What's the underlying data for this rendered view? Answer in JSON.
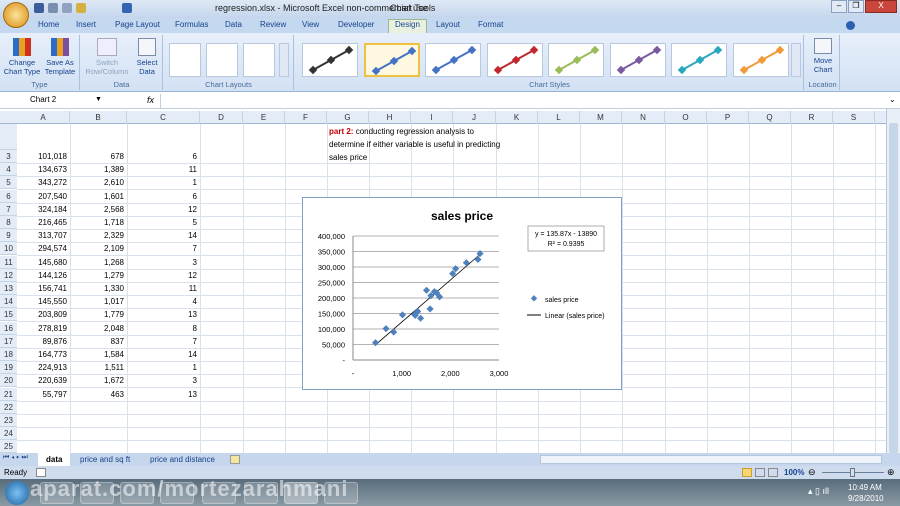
{
  "window": {
    "title": "regression.xlsx - Microsoft Excel non-commercial use",
    "context": "Chart Tools",
    "min": "–",
    "max": "❐",
    "close": "X"
  },
  "tabs": [
    "Home",
    "Insert",
    "Page Layout",
    "Formulas",
    "Data",
    "Review",
    "View",
    "Developer",
    "Design",
    "Layout",
    "Format"
  ],
  "active_tab": "Design",
  "ribbon": {
    "type": {
      "label": "Type",
      "change": "Change Chart Type",
      "save": "Save As Template"
    },
    "data": {
      "label": "Data",
      "switch": "Switch Row/Column",
      "select": "Select Data"
    },
    "layouts": {
      "label": "Chart Layouts"
    },
    "styles": {
      "label": "Chart Styles",
      "colors": [
        "#333333",
        "#4472c4",
        "#4472c4",
        "#c0282e",
        "#9bbb59",
        "#7a5a9e",
        "#2aa8c0",
        "#f29a3a"
      ]
    },
    "location": {
      "label": "Location",
      "move": "Move Chart"
    }
  },
  "formula_bar": {
    "name_box": "Chart 2",
    "fx": "fx",
    "value": ""
  },
  "columns": [
    "A",
    "B",
    "C",
    "D",
    "E",
    "F",
    "G",
    "H",
    "I",
    "J",
    "K",
    "L",
    "M",
    "N",
    "O",
    "P",
    "Q",
    "R",
    "S"
  ],
  "rows": [
    {
      "n": "3",
      "a": "101,018",
      "b": "678",
      "c": "6"
    },
    {
      "n": "4",
      "a": "134,673",
      "b": "1,389",
      "c": "11"
    },
    {
      "n": "5",
      "a": "343,272",
      "b": "2,610",
      "c": "1"
    },
    {
      "n": "6",
      "a": "207,540",
      "b": "1,601",
      "c": "6"
    },
    {
      "n": "7",
      "a": "324,184",
      "b": "2,568",
      "c": "12"
    },
    {
      "n": "8",
      "a": "216,465",
      "b": "1,718",
      "c": "5"
    },
    {
      "n": "9",
      "a": "313,707",
      "b": "2,329",
      "c": "14"
    },
    {
      "n": "10",
      "a": "294,574",
      "b": "2,109",
      "c": "7"
    },
    {
      "n": "11",
      "a": "145,680",
      "b": "1,268",
      "c": "3"
    },
    {
      "n": "12",
      "a": "144,126",
      "b": "1,279",
      "c": "12"
    },
    {
      "n": "13",
      "a": "156,741",
      "b": "1,330",
      "c": "11"
    },
    {
      "n": "14",
      "a": "145,550",
      "b": "1,017",
      "c": "4"
    },
    {
      "n": "15",
      "a": "203,809",
      "b": "1,779",
      "c": "13"
    },
    {
      "n": "16",
      "a": "278,819",
      "b": "2,048",
      "c": "8"
    },
    {
      "n": "17",
      "a": "89,876",
      "b": "837",
      "c": "7"
    },
    {
      "n": "18",
      "a": "164,773",
      "b": "1,584",
      "c": "14"
    },
    {
      "n": "19",
      "a": "224,913",
      "b": "1,511",
      "c": "1"
    },
    {
      "n": "20",
      "a": "220,639",
      "b": "1,672",
      "c": "3"
    },
    {
      "n": "21",
      "a": "55,797",
      "b": "463",
      "c": "13"
    },
    {
      "n": "22",
      "a": "",
      "b": "",
      "c": ""
    },
    {
      "n": "23",
      "a": "",
      "b": "",
      "c": ""
    },
    {
      "n": "24",
      "a": "",
      "b": "",
      "c": ""
    },
    {
      "n": "25",
      "a": "",
      "b": "",
      "c": ""
    }
  ],
  "note": {
    "label": "part 2:",
    "text": "conducting regression analysis to determine if either variable is useful in predicting sales price"
  },
  "chart_data": {
    "type": "scatter",
    "title": "sales price",
    "x": [
      678,
      1389,
      2610,
      1601,
      2568,
      1718,
      2329,
      2109,
      1268,
      1279,
      1330,
      1017,
      1779,
      2048,
      837,
      1584,
      1511,
      1672,
      463
    ],
    "y": [
      101018,
      134673,
      343272,
      207540,
      324184,
      216465,
      313707,
      294574,
      145680,
      144126,
      156741,
      145550,
      203809,
      278819,
      89876,
      164773,
      224913,
      220639,
      55797
    ],
    "xlim": [
      0,
      3000
    ],
    "ylim": [
      0,
      400000
    ],
    "xticks": [
      "-",
      "1,000",
      "2,000",
      "3,000"
    ],
    "yticks": [
      "-",
      "50,000",
      "100,000",
      "150,000",
      "200,000",
      "250,000",
      "300,000",
      "350,000",
      "400,000"
    ],
    "trendline": {
      "slope": 135.87,
      "intercept": -13890,
      "equation": "y = 135.87x - 13890",
      "r2": "R² = 0.9395"
    },
    "legend": [
      "sales price",
      "Linear (sales price)"
    ],
    "legend_position": "right",
    "grid": true,
    "marker_color": "#4f81bd"
  },
  "sheets": [
    "data",
    "price and sq ft",
    "price and distance"
  ],
  "status": {
    "ready": "Ready",
    "zoom": "100%"
  },
  "clock": {
    "time": "10:49 AM",
    "date": "9/28/2010"
  },
  "watermark": "aparat.com/mortezarahmani"
}
